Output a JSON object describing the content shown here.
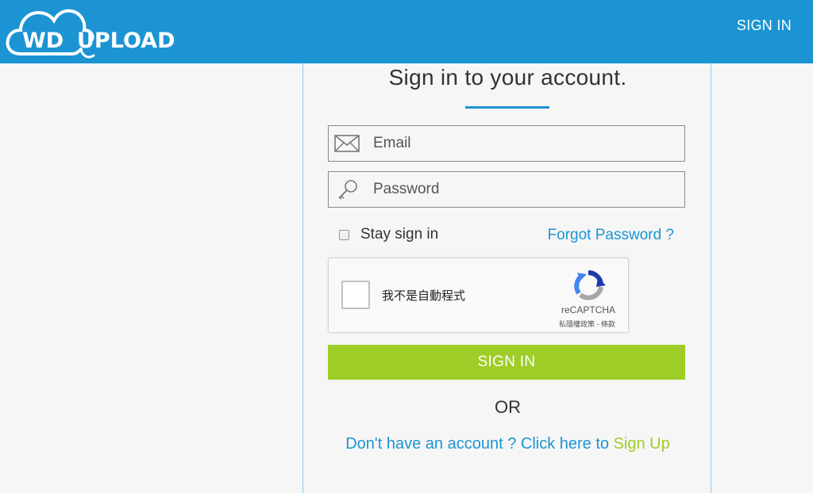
{
  "header": {
    "logo_part1": "WD",
    "logo_part2": "UPLOAD",
    "signin_link": "SIGN IN"
  },
  "form": {
    "title": "Sign in to your account.",
    "email_placeholder": "Email",
    "password_placeholder": "Password",
    "stay_signed_in_label": "Stay sign in",
    "forgot_password": "Forgot Password ?",
    "signin_button": "SIGN IN",
    "or_text": "OR",
    "signup_prompt": "Don't have an account ? Click here to",
    "signup_link": "Sign Up"
  },
  "captcha": {
    "label": "我不是自動程式",
    "brand": "reCAPTCHA",
    "terms": "私隱權政策 - 條款"
  },
  "colors": {
    "brand_blue": "#1c94d3",
    "accent_green": "#9fcd27",
    "background": "#f6f6f6"
  },
  "icons": {
    "email": "envelope-icon",
    "password": "key-icon",
    "captcha": "recaptcha-logo-icon",
    "logo": "cloud-icon"
  }
}
